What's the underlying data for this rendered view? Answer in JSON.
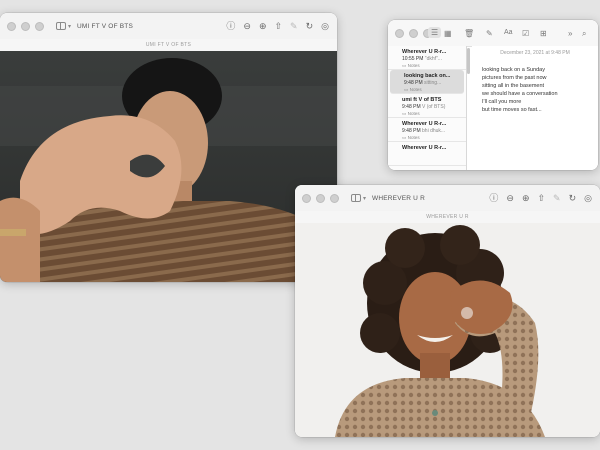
{
  "window_left": {
    "title": "UMI FT V OF BTS",
    "subtitle": "UMI FT V OF BTS"
  },
  "window_right": {
    "title": "WHEREVER U R",
    "subtitle": "WHEREVER U R"
  },
  "notes": {
    "date": "December 23, 2021 at 9:48 PM",
    "items": [
      {
        "title": "Wherever U R-r...",
        "time": "10:55 PM",
        "preview": "\"dkhf\"...",
        "folder": "Notes"
      },
      {
        "title": "looking back on...",
        "time": "9:48 PM",
        "preview": "sitting...",
        "folder": "Notes"
      },
      {
        "title": "umi ft V of BTS",
        "time": "9:48 PM",
        "preview": "V (of BTS)",
        "folder": "Notes"
      },
      {
        "title": "Wherever U R-r...",
        "time": "9:48 PM",
        "preview": "bhi dhuk...",
        "folder": "Notes"
      },
      {
        "title": "Wherever U R-r...",
        "time": "",
        "preview": "",
        "folder": ""
      }
    ],
    "body_lines": [
      "looking back on a Sunday",
      "pictures from the past now",
      "sitting all in the basement",
      "we should have a conversation",
      "I'll call you more",
      "but time moves so fast..."
    ]
  },
  "icons": [
    "sidebar-icon",
    "info-icon",
    "zoom-out-icon",
    "zoom-in-icon",
    "share-icon",
    "markup-icon",
    "rotate-icon",
    "search-icon"
  ]
}
